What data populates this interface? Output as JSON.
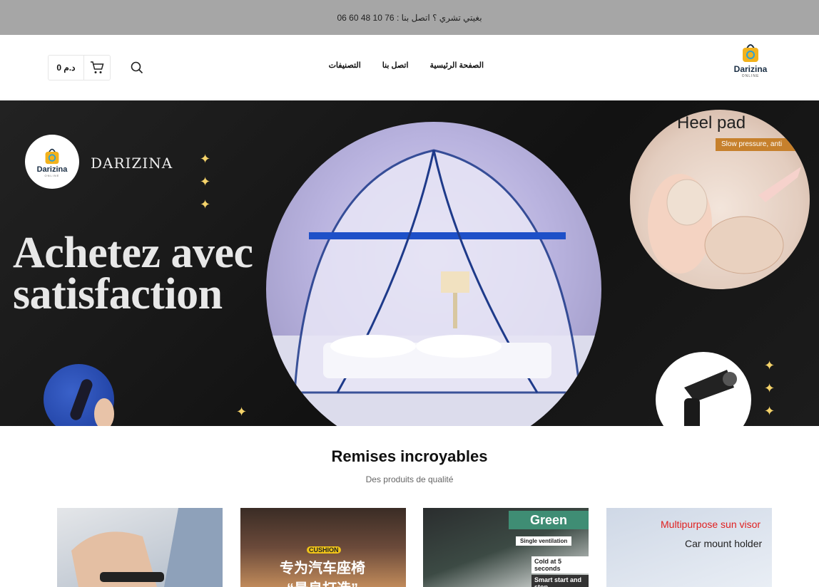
{
  "topbar": {
    "text": "بغيتي تشري ؟  اتصل بنا  : 76 10 48 60 06"
  },
  "header": {
    "cart_total": "0 د.م",
    "nav": [
      "الصفحة الرئيسية",
      "اتصل بنا",
      "التصنيفات"
    ],
    "logo": {
      "word": "Darizina",
      "sub": "ONLINE"
    }
  },
  "hero": {
    "brand": "DARIZINA",
    "headline_1": "Achetez avec",
    "headline_2": "satisfaction",
    "badge_word": "Darizina",
    "badge_sub": "ONLINE",
    "heel_title": "Heel pad",
    "heel_banner": "Slow pressure, anti"
  },
  "section": {
    "title": "Remises incroyables",
    "subtitle": "Des produits de qualité"
  },
  "cards": [
    {
      "label": ""
    },
    {
      "label": "专为汽车座椅 “最良打造”",
      "tag": "CUSHION"
    },
    {
      "label": "Green",
      "lines": [
        "Single ventilation",
        "Cold at 5 seconds",
        "Smart start and stop"
      ]
    },
    {
      "label": "Multipurpose sun visor",
      "line": "Car mount holder"
    }
  ],
  "colors": {
    "topbar": "#a6a6a6",
    "hero_bg": "#171717",
    "sparkle": "#f5d36a",
    "logo_text": "#1a2e44"
  }
}
